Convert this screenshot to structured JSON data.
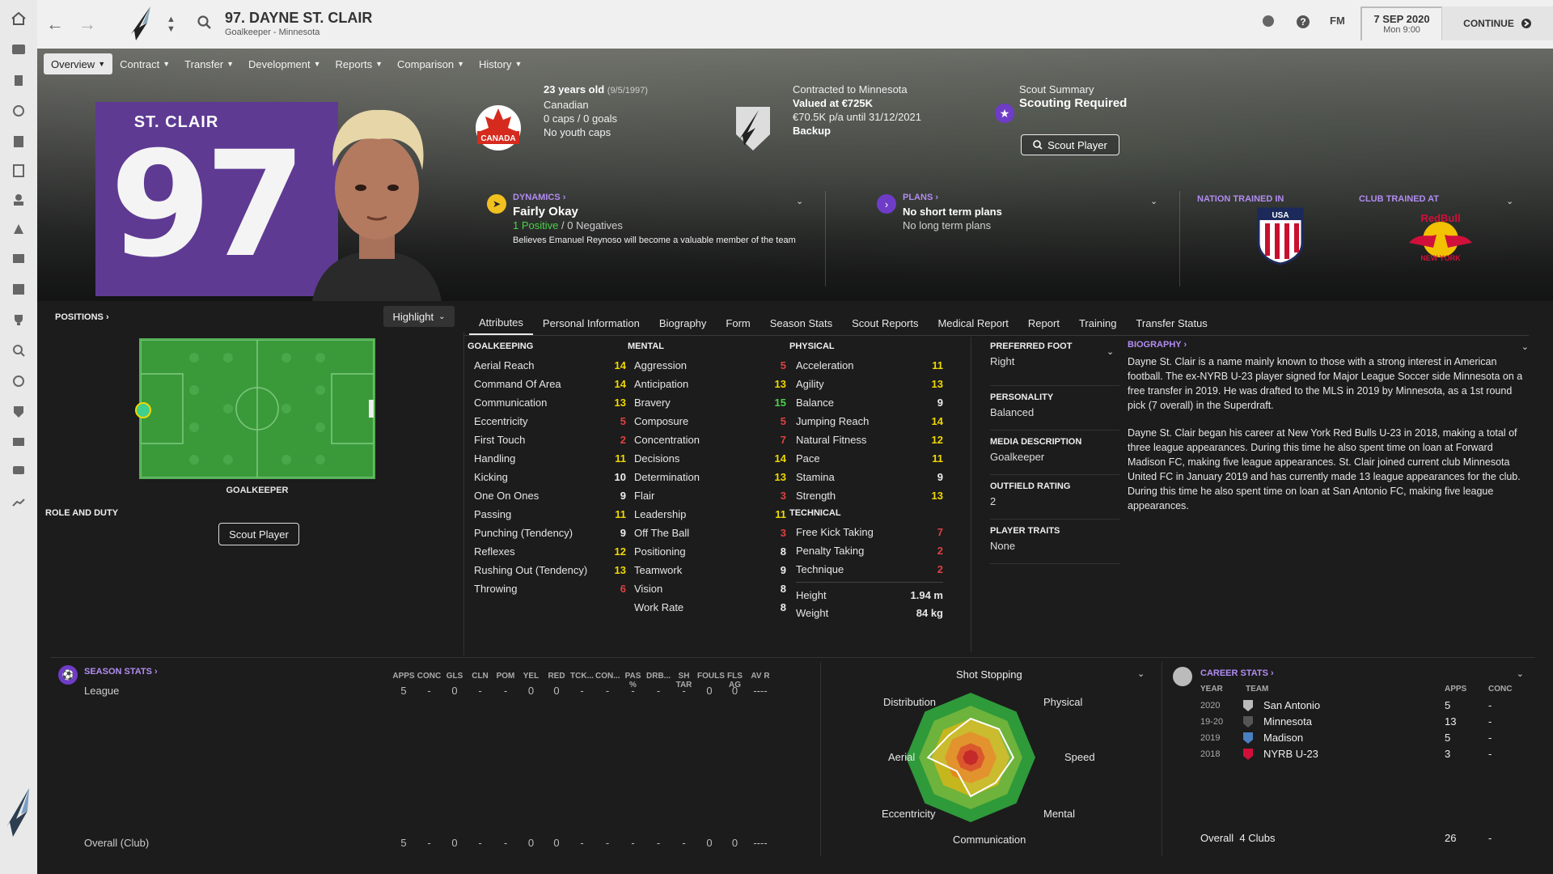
{
  "topbar": {
    "title": "97. DAYNE ST. CLAIR",
    "subtitle": "Goalkeeper - Minnesota",
    "right_label": "FM",
    "date": "7 SEP 2020",
    "time": "Mon 9:00",
    "continue_label": "CONTINUE"
  },
  "subnav": [
    {
      "label": "Overview"
    },
    {
      "label": "Contract"
    },
    {
      "label": "Transfer"
    },
    {
      "label": "Development"
    },
    {
      "label": "Reports"
    },
    {
      "label": "Comparison"
    },
    {
      "label": "History"
    }
  ],
  "hero": {
    "shirt_name": "ST. CLAIR",
    "shirt_number": "97",
    "age": "23 years old",
    "dob": "(9/5/1997)",
    "nationality": "Canadian",
    "caps": "0 caps / 0 goals",
    "youth_caps": "No youth caps",
    "flag_text": "CANADA",
    "contract": "Contracted to Minnesota",
    "value": "Valued at €725K",
    "wage": "€70.5K p/a until 31/12/2021",
    "squad_status": "Backup",
    "scout_summary_label": "Scout Summary",
    "scout_summary_value": "Scouting Required",
    "scout_button": "Scout Player",
    "dynamics_label": "DYNAMICS",
    "dynamics_value": "Fairly Okay",
    "positives": "1 Positive",
    "negatives": "0 Negatives",
    "dynamics_note": "Believes Emanuel Reynoso will become a valuable member of the team",
    "plans_label": "PLANS",
    "plans_short": "No short term plans",
    "plans_long": "No long term plans",
    "nation_trained_label": "NATION TRAINED IN",
    "club_trained_label": "CLUB TRAINED AT",
    "club_trained_crest_text": "RedBull",
    "club_trained_crest_sub": "NEW YORK"
  },
  "positions": {
    "title": "POSITIONS",
    "highlight_label": "Highlight",
    "pitch_label": "GOALKEEPER",
    "role_title": "ROLE AND DUTY",
    "scout_button": "Scout Player"
  },
  "tabs": [
    {
      "label": "Attributes",
      "active": true
    },
    {
      "label": "Personal Information"
    },
    {
      "label": "Biography"
    },
    {
      "label": "Form"
    },
    {
      "label": "Season Stats"
    },
    {
      "label": "Scout Reports"
    },
    {
      "label": "Medical Report"
    },
    {
      "label": "Report"
    },
    {
      "label": "Training"
    },
    {
      "label": "Transfer Status"
    }
  ],
  "colors": {
    "good": "#f0d800",
    "great": "#4bd24b",
    "bad": "#e04040",
    "normal": "#eeeeee",
    "accent": "#b28cf2"
  },
  "attributes": {
    "goalkeeping": {
      "title": "GOALKEEPING",
      "items": [
        {
          "name": "Aerial Reach",
          "value": "14"
        },
        {
          "name": "Command Of Area",
          "value": "14"
        },
        {
          "name": "Communication",
          "value": "13"
        },
        {
          "name": "Eccentricity",
          "value": "5"
        },
        {
          "name": "First Touch",
          "value": "2"
        },
        {
          "name": "Handling",
          "value": "11"
        },
        {
          "name": "Kicking",
          "value": "10"
        },
        {
          "name": "One On Ones",
          "value": "9"
        },
        {
          "name": "Passing",
          "value": "11"
        },
        {
          "name": "Punching (Tendency)",
          "value": "9"
        },
        {
          "name": "Reflexes",
          "value": "12"
        },
        {
          "name": "Rushing Out (Tendency)",
          "value": "13"
        },
        {
          "name": "Throwing",
          "value": "6"
        }
      ]
    },
    "mental": {
      "title": "MENTAL",
      "items": [
        {
          "name": "Aggression",
          "value": "5"
        },
        {
          "name": "Anticipation",
          "value": "13"
        },
        {
          "name": "Bravery",
          "value": "15"
        },
        {
          "name": "Composure",
          "value": "5"
        },
        {
          "name": "Concentration",
          "value": "7"
        },
        {
          "name": "Decisions",
          "value": "14"
        },
        {
          "name": "Determination",
          "value": "13"
        },
        {
          "name": "Flair",
          "value": "3"
        },
        {
          "name": "Leadership",
          "value": "11"
        },
        {
          "name": "Off The Ball",
          "value": "3"
        },
        {
          "name": "Positioning",
          "value": "8"
        },
        {
          "name": "Teamwork",
          "value": "9"
        },
        {
          "name": "Vision",
          "value": "8"
        },
        {
          "name": "Work Rate",
          "value": "8"
        }
      ]
    },
    "physical": {
      "title": "PHYSICAL",
      "items": [
        {
          "name": "Acceleration",
          "value": "11"
        },
        {
          "name": "Agility",
          "value": "13"
        },
        {
          "name": "Balance",
          "value": "9"
        },
        {
          "name": "Jumping Reach",
          "value": "14"
        },
        {
          "name": "Natural Fitness",
          "value": "12"
        },
        {
          "name": "Pace",
          "value": "11"
        },
        {
          "name": "Stamina",
          "value": "9"
        },
        {
          "name": "Strength",
          "value": "13"
        }
      ]
    },
    "technical": {
      "title": "TECHNICAL",
      "items": [
        {
          "name": "Free Kick Taking",
          "value": "7"
        },
        {
          "name": "Penalty Taking",
          "value": "2"
        },
        {
          "name": "Technique",
          "value": "2"
        }
      ]
    },
    "height_label": "Height",
    "height": "1.94 m",
    "weight_label": "Weight",
    "weight": "84 kg"
  },
  "details": [
    {
      "title": "PREFERRED FOOT",
      "value": "Right"
    },
    {
      "title": "PERSONALITY",
      "value": "Balanced"
    },
    {
      "title": "MEDIA DESCRIPTION",
      "value": "Goalkeeper"
    },
    {
      "title": "OUTFIELD RATING",
      "value": "2"
    },
    {
      "title": "PLAYER TRAITS",
      "value": "None"
    }
  ],
  "biography": {
    "title": "BIOGRAPHY",
    "p1": "Dayne St. Clair is a name mainly known to those with a strong interest in American football. The ex-NYRB U-23 player signed for Major League Soccer side Minnesota on a free transfer in 2019. He was drafted to the MLS in 2019 by Minnesota, as a 1st round pick (7 overall) in the Superdraft.",
    "p2": "Dayne St. Clair began his career at New York Red Bulls U-23 in 2018, making a total of three league appearances. During this time he also spent time on loan at Forward Madison FC, making five league appearances. St. Clair joined current club Minnesota United FC in January 2019 and has currently made 13 league appearances for the club. During this time he also spent time on loan at San Antonio FC, making five league appearances."
  },
  "season_stats": {
    "title": "SEASON STATS",
    "headers": [
      "APPS",
      "CONC",
      "GLS",
      "CLN",
      "POM",
      "YEL",
      "RED",
      "TCK...",
      "CON...",
      "PAS %",
      "DRB...",
      "SH TAR",
      "FOULS",
      "FLS AG",
      "AV R"
    ],
    "league_label": "League",
    "league_values": [
      "5",
      "-",
      "0",
      "-",
      "-",
      "0",
      "0",
      "-",
      "-",
      "-",
      "-",
      "-",
      "0",
      "0",
      "----"
    ],
    "overall_label": "Overall (Club)",
    "overall_values": [
      "5",
      "-",
      "0",
      "-",
      "-",
      "0",
      "0",
      "-",
      "-",
      "-",
      "-",
      "-",
      "0",
      "0",
      "----"
    ]
  },
  "radar": {
    "dropdown_label": "Shot Stopping",
    "labels": {
      "top": "Shot Stopping",
      "physical": "Physical",
      "speed": "Speed",
      "mental": "Mental",
      "communication": "Communication",
      "eccentricity": "Eccentricity",
      "aerial": "Aerial",
      "distribution": "Distribution"
    },
    "axes": [
      "Shot Stopping",
      "Physical",
      "Speed",
      "Mental",
      "Communication",
      "Eccentricity",
      "Aerial",
      "Distribution"
    ],
    "values": [
      0.6,
      0.62,
      0.66,
      0.55,
      0.6,
      0.3,
      0.66,
      0.48
    ]
  },
  "career_stats": {
    "title": "CAREER STATS",
    "headers": {
      "year": "YEAR",
      "team": "TEAM",
      "apps": "APPS",
      "conc": "CONC"
    },
    "rows": [
      {
        "year": "2020",
        "team": "San Antonio",
        "apps": "5",
        "conc": "-"
      },
      {
        "year": "19-20",
        "team": "Minnesota",
        "apps": "13",
        "conc": "-"
      },
      {
        "year": "2019",
        "team": "Madison",
        "apps": "5",
        "conc": "-"
      },
      {
        "year": "2018",
        "team": "NYRB U-23",
        "apps": "3",
        "conc": "-"
      }
    ],
    "overall_label": "Overall",
    "overall_clubs": "4 Clubs",
    "overall_apps": "26",
    "overall_conc": "-"
  }
}
